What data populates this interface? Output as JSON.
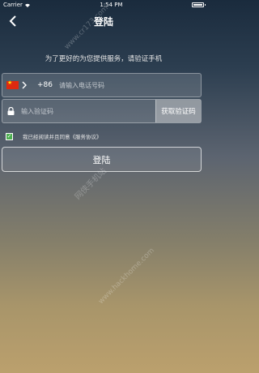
{
  "status_bar": {
    "carrier": "Carrier",
    "time": "1:54 PM",
    "wifi_icon": "wifi-icon",
    "battery_icon": "battery-icon"
  },
  "nav": {
    "title": "登陆",
    "back_icon": "chevron-left-icon"
  },
  "intro_text": "为了更好的为您提供服务，请验证手机",
  "phone": {
    "flag_icon": "china-flag-icon",
    "chevron_icon": "chevron-right-icon",
    "country_code": "+86",
    "placeholder": "请输入电话号码",
    "value": ""
  },
  "code": {
    "lock_icon": "lock-icon",
    "placeholder": "输入验证码",
    "value": "",
    "get_code_label": "获取验证码"
  },
  "agreement": {
    "checked": true,
    "text": "我已经阅读并且同意《服务协议》"
  },
  "login_label": "登陆",
  "watermarks": [
    "www.cr173.com",
    "网侠手机站",
    "www.hackhome.com"
  ],
  "colors": {
    "checkbox_green": "#4caf50",
    "flag_red": "#de2910",
    "flag_star": "#ffde00"
  }
}
